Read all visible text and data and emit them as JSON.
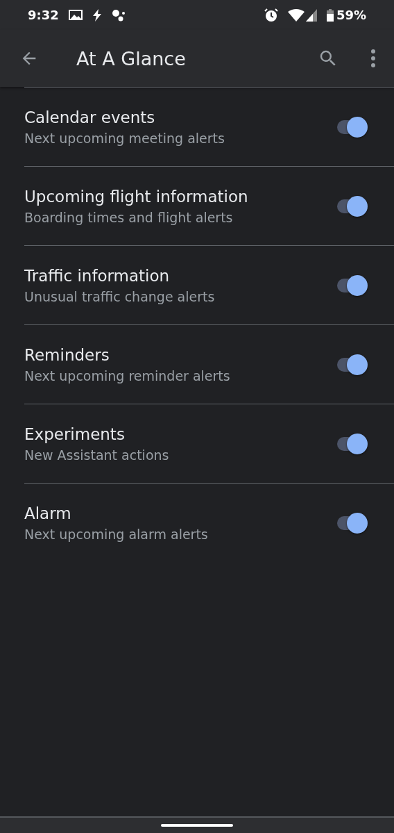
{
  "status_bar": {
    "time": "9:32",
    "battery": "59%"
  },
  "toolbar": {
    "title": "At A Glance"
  },
  "settings": [
    {
      "title": "Calendar events",
      "summary": "Next upcoming meeting alerts",
      "on": true
    },
    {
      "title": "Upcoming flight information",
      "summary": "Boarding times and flight alerts",
      "on": true
    },
    {
      "title": "Traffic information",
      "summary": "Unusual traffic change alerts",
      "on": true
    },
    {
      "title": "Reminders",
      "summary": "Next upcoming reminder alerts",
      "on": true
    },
    {
      "title": "Experiments",
      "summary": "New Assistant actions",
      "on": true
    },
    {
      "title": "Alarm",
      "summary": "Next upcoming alarm alerts",
      "on": true
    }
  ]
}
